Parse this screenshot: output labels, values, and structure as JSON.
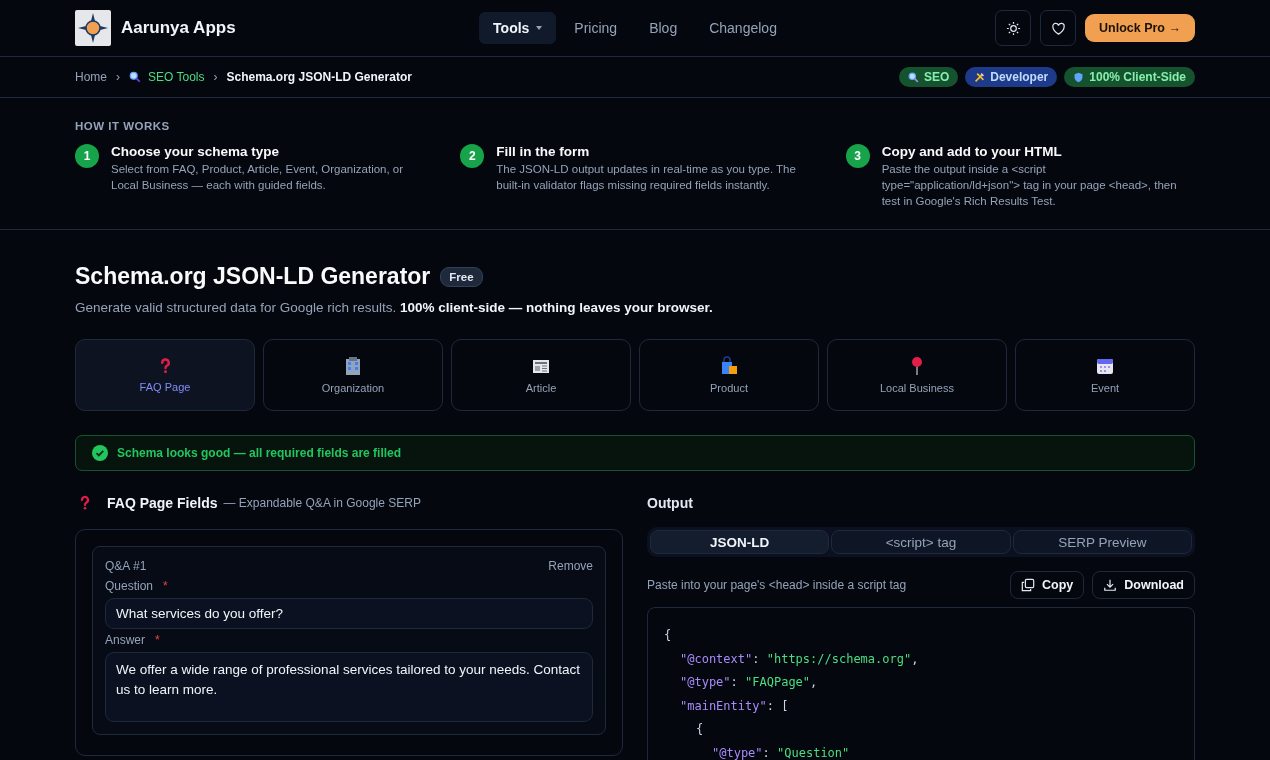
{
  "brand": {
    "name": "Aarunya Apps"
  },
  "nav": [
    {
      "label": "Tools",
      "selected": true,
      "dropdown": true
    },
    {
      "label": "Pricing",
      "selected": false,
      "dropdown": false
    },
    {
      "label": "Blog",
      "selected": false,
      "dropdown": false
    },
    {
      "label": "Changelog",
      "selected": false,
      "dropdown": false
    }
  ],
  "cta": "Unlock Pro →",
  "breadcrumb": [
    {
      "label": "Home",
      "kind": "plain"
    },
    {
      "label": "SEO Tools",
      "kind": "category"
    },
    {
      "label": "Schema.org JSON-LD Generator",
      "kind": "current"
    }
  ],
  "separator": "›",
  "badges": [
    {
      "label": "SEO",
      "color": "#14532d"
    },
    {
      "label": "Developer",
      "color": "#1e3a8a"
    },
    {
      "label": "100% Client-Side",
      "color": "#14532d"
    }
  ],
  "how_it_works": {
    "title": "HOW IT WORKS",
    "steps": [
      {
        "number": "1",
        "title": "Choose your schema type",
        "text": "Select from FAQ, Product, Article, Event, Organization, or Local Business — each with guided fields."
      },
      {
        "number": "2",
        "title": "Fill in the form",
        "text": "The JSON-LD output updates in real-time as you type. The built-in validator flags missing required fields instantly."
      },
      {
        "number": "3",
        "title": "Copy and add to your HTML",
        "text": "Paste the output inside a <script type=\"application/ld+json\"> tag in your page <head>, then test in Google's Rich Results Test."
      }
    ]
  },
  "page": {
    "title": "Schema.org JSON-LD Generator",
    "badge": "Free",
    "subtitle": "Generate valid structured data for Google rich results. **100% client-side — nothing leaves your browser.**"
  },
  "schema_types": [
    {
      "label": "FAQ Page",
      "selected": true
    },
    {
      "label": "Organization",
      "selected": false
    },
    {
      "label": "Article",
      "selected": false
    },
    {
      "label": "Product",
      "selected": false
    },
    {
      "label": "Local Business",
      "selected": false
    },
    {
      "label": "Event",
      "selected": false
    }
  ],
  "validation": {
    "valid": true,
    "message": "Schema looks good — all required fields are filled"
  },
  "required_mark": "*",
  "fields": {
    "title": "FAQ Page Fields",
    "hint": "— Expandable Q&A in Google SERP",
    "items": [
      {
        "label": "Q&A #1",
        "remove": "Remove",
        "question_label": "Question",
        "question_required": true,
        "question": "What services do you offer?",
        "answer_label": "Answer",
        "answer_required": true,
        "answer": "We offer a wide range of professional services tailored to your needs. Contact us to learn more."
      }
    ]
  },
  "output": {
    "title": "Output",
    "tabs": [
      {
        "label": "JSON-LD",
        "selected": true
      },
      {
        "label": "<script> tag",
        "selected": false
      },
      {
        "label": "SERP Preview",
        "selected": false
      }
    ],
    "hint": "Paste into your page's <head> inside a script tag",
    "copy": "Copy",
    "download": "Download",
    "code": [
      {
        "tokens": [
          {
            "kind": "punct",
            "text": "{"
          }
        ],
        "children": [
          {
            "tokens": [
              {
                "kind": "key",
                "text": "\"@context\""
              },
              {
                "kind": "punct",
                "text": ": "
              },
              {
                "kind": "str",
                "text": "\"https://schema.org\""
              },
              {
                "kind": "punct",
                "text": ","
              }
            ]
          },
          {
            "tokens": [
              {
                "kind": "key",
                "text": "\"@type\""
              },
              {
                "kind": "punct",
                "text": ": "
              },
              {
                "kind": "str",
                "text": "\"FAQPage\""
              },
              {
                "kind": "punct",
                "text": ","
              }
            ]
          },
          {
            "tokens": [
              {
                "kind": "key",
                "text": "\"mainEntity\""
              },
              {
                "kind": "punct",
                "text": ": ["
              }
            ],
            "children": [
              {
                "tokens": [
                  {
                    "kind": "punct",
                    "text": "{"
                  }
                ],
                "children": [
                  {
                    "tokens": [
                      {
                        "kind": "key",
                        "text": "\"@type\""
                      },
                      {
                        "kind": "punct",
                        "text": ": "
                      },
                      {
                        "kind": "str",
                        "text": "\"Question\""
                      }
                    ]
                  }
                ]
              }
            ]
          }
        ]
      }
    ]
  }
}
